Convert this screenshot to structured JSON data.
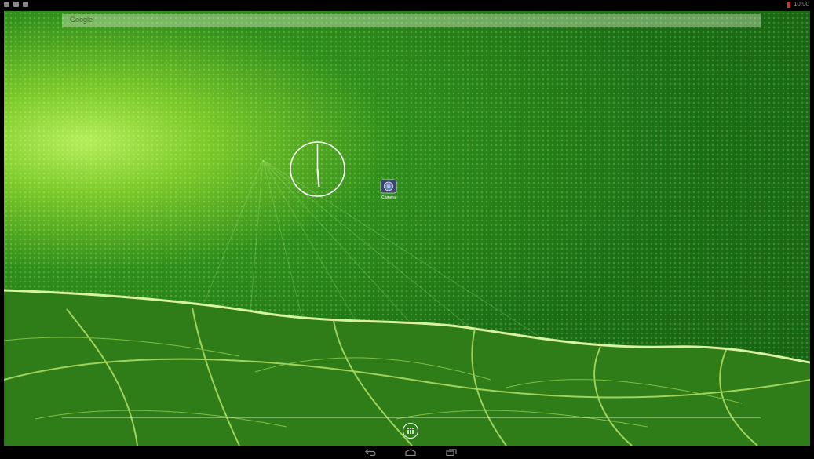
{
  "search": {
    "placeholder": "Google"
  },
  "status_bar": {
    "time": "10:00"
  },
  "clock": {
    "hour_hand_angle": 175,
    "minute_hand_angle": 0
  },
  "apps": [
    {
      "label": "Camera",
      "icon": "camera-icon"
    }
  ],
  "app_drawer": {
    "icon": "all-apps-icon"
  },
  "nav": {
    "back": "back-icon",
    "home": "home-icon",
    "recents": "recents-icon"
  },
  "colors": {
    "wallpaper_primary": "#1a6f14",
    "wallpaper_highlight": "#b4ee5a",
    "bar_background": "#000000"
  }
}
